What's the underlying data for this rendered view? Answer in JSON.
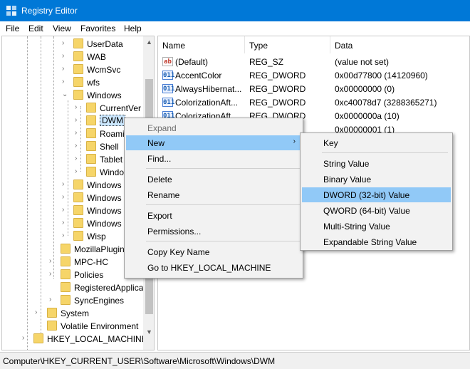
{
  "window": {
    "title": "Registry Editor"
  },
  "menubar": [
    "File",
    "Edit",
    "View",
    "Favorites",
    "Help"
  ],
  "tree": {
    "items": [
      {
        "label": "UserData",
        "expander": "›"
      },
      {
        "label": "WAB",
        "expander": "›"
      },
      {
        "label": "WcmSvc",
        "expander": "›"
      },
      {
        "label": "wfs",
        "expander": "›"
      },
      {
        "label": "Windows",
        "expander": "⌄"
      },
      {
        "label": "CurrentVer",
        "expander": "›"
      },
      {
        "label": "DWM",
        "expander": "›",
        "selected": true
      },
      {
        "label": "Roami",
        "expander": "›"
      },
      {
        "label": "Shell",
        "expander": "›"
      },
      {
        "label": "Tablet",
        "expander": "›"
      },
      {
        "label": "Windo",
        "expander": "›"
      },
      {
        "label": "Windows",
        "expander": "›"
      },
      {
        "label": "Windows",
        "expander": "›"
      },
      {
        "label": "Windows",
        "expander": "›"
      },
      {
        "label": "Windows",
        "expander": "›"
      },
      {
        "label": "Wisp",
        "expander": "›"
      },
      {
        "label": "MozillaPlugin",
        "expander": ""
      },
      {
        "label": "MPC-HC",
        "expander": "›"
      },
      {
        "label": "Policies",
        "expander": "›"
      },
      {
        "label": "RegisteredApplica",
        "expander": ""
      },
      {
        "label": "SyncEngines",
        "expander": "›"
      },
      {
        "label": "System",
        "expander": "›"
      },
      {
        "label": "Volatile Environment",
        "expander": ""
      },
      {
        "label": "HKEY_LOCAL_MACHINE",
        "expander": "›"
      }
    ]
  },
  "list": {
    "columns": [
      "Name",
      "Type",
      "Data"
    ],
    "rows": [
      {
        "icon": "ab",
        "name": "(Default)",
        "type": "REG_SZ",
        "data": "(value not set)"
      },
      {
        "icon": "011",
        "name": "AccentColor",
        "type": "REG_DWORD",
        "data": "0x00d77800 (14120960)"
      },
      {
        "icon": "011",
        "name": "AlwaysHibernat...",
        "type": "REG_DWORD",
        "data": "0x00000000 (0)"
      },
      {
        "icon": "011",
        "name": "ColorizationAft...",
        "type": "REG_DWORD",
        "data": "0xc40078d7 (3288365271)"
      },
      {
        "icon": "011",
        "name": "ColorizationAft...",
        "type": "REG_DWORD",
        "data": "0x0000000a (10)"
      },
      {
        "icon": "011",
        "name": "",
        "type": "",
        "data": "0x00000001 (1)"
      }
    ]
  },
  "context_menu": {
    "items": [
      "Expand",
      "New",
      "Find...",
      "Delete",
      "Rename",
      "Export",
      "Permissions...",
      "Copy Key Name",
      "Go to HKEY_LOCAL_MACHINE"
    ],
    "submenu_arrow": "›"
  },
  "submenu": {
    "items": [
      "Key",
      "String Value",
      "Binary Value",
      "DWORD (32-bit) Value",
      "QWORD (64-bit) Value",
      "Multi-String Value",
      "Expandable String Value"
    ]
  },
  "statusbar": {
    "path": "Computer\\HKEY_CURRENT_USER\\Software\\Microsoft\\Windows\\DWM"
  },
  "colors": {
    "titlebar": "#0078d7",
    "highlight": "#91c9f7",
    "folder": "#f6d569"
  }
}
